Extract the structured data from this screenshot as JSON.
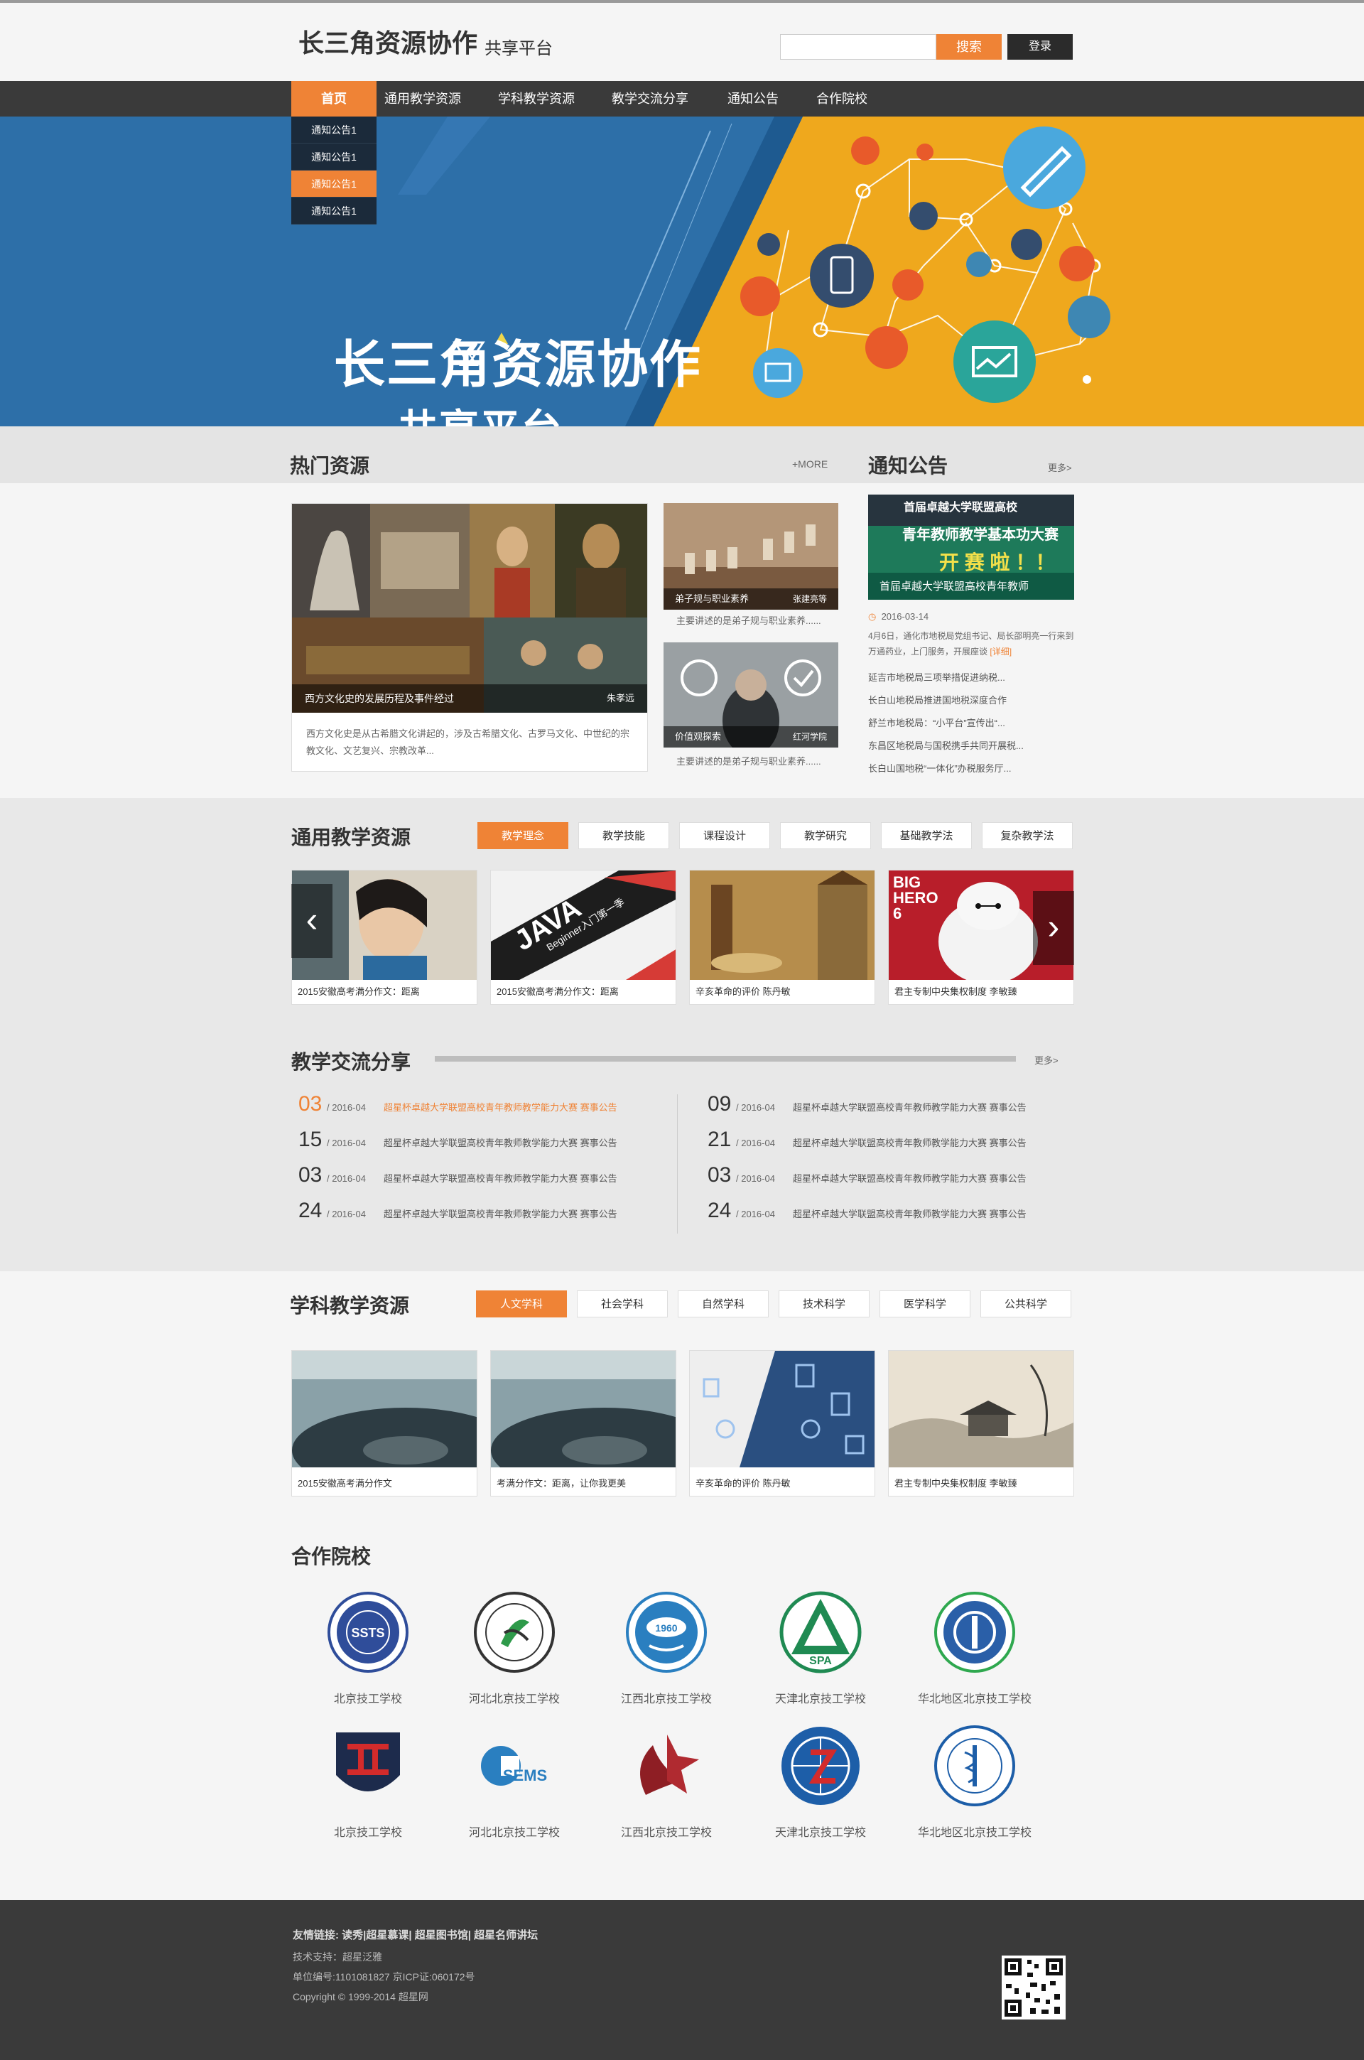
{
  "header": {
    "logo_main": "长三角资源协作",
    "logo_sub": "共享平台",
    "search_placeholder": "",
    "search_label": "搜索",
    "login_label": "登录"
  },
  "nav": {
    "items": [
      "首页",
      "通用教学资源",
      "学科教学资源",
      "教学交流分享",
      "通知公告",
      "合作院校"
    ],
    "dropdown": [
      "通知公告1",
      "通知公告1",
      "通知公告1",
      "通知公告1"
    ]
  },
  "banner": {
    "title": "长三角资源协作",
    "subtitle": "共享平台"
  },
  "hot": {
    "title": "热门资源",
    "more": "+MORE",
    "main": {
      "caption": "西方文化史的发展历程及事件经过",
      "author": "朱孝远",
      "desc": "西方文化史是从古希腊文化讲起的，涉及古希腊文化、古罗马文化、中世纪的宗教文化、文艺复兴、宗教改革..."
    },
    "side": [
      {
        "caption": "弟子规与职业素养",
        "author": "张建亮等",
        "desc": "主要讲述的是弟子规与职业素养......"
      },
      {
        "caption": "价值观探索",
        "author": "红河学院",
        "desc": "主要讲述的是弟子规与职业素养......"
      }
    ]
  },
  "notice": {
    "title": "通知公告",
    "more": "更多>",
    "img_line1": "首届卓越大学联盟高校",
    "img_line2": "青年教师教学基本功大赛",
    "img_line3": "开 赛 啦 ！！",
    "img_caption": "首届卓越大学联盟高校青年教师",
    "date": "2016-03-14",
    "summary": "4月6日，通化市地税局党组书记、局长邵明亮一行来到万通药业，上门服务，开展座谈",
    "detail": "[详细]",
    "items": [
      "延吉市地税局三项举措促进纳税...",
      "长白山地税局推进国地税深度合作",
      "舒兰市地税局：“小平台”宣传出“...",
      "东昌区地税局与国税携手共同开展税...",
      "长白山国地税“一体化”办税服务厅..."
    ]
  },
  "general": {
    "title": "通用教学资源",
    "tabs": [
      "教学理念",
      "教学技能",
      "课程设计",
      "教学研究",
      "基础教学法",
      "复杂教学法"
    ],
    "tiles": [
      "2015安徽高考满分作文：距离",
      "2015安徽高考满分作文：距离",
      "辛亥革命的评价    陈丹敏",
      "君主专制中央集权制度 李敏臻"
    ],
    "java_text": "JAVA",
    "java_sub": "Beginner入门第一季",
    "big_hero": "BIG HERO 6"
  },
  "exchange": {
    "title": "教学交流分享",
    "more": "更多>",
    "left": [
      {
        "day": "03",
        "date": "/ 2016-04",
        "text": "超星杯卓越大学联盟高校青年教师教学能力大赛 赛事公告"
      },
      {
        "day": "15",
        "date": "/ 2016-04",
        "text": "超星杯卓越大学联盟高校青年教师教学能力大赛 赛事公告"
      },
      {
        "day": "03",
        "date": "/ 2016-04",
        "text": "超星杯卓越大学联盟高校青年教师教学能力大赛 赛事公告"
      },
      {
        "day": "24",
        "date": "/ 2016-04",
        "text": "超星杯卓越大学联盟高校青年教师教学能力大赛 赛事公告"
      }
    ],
    "right": [
      {
        "day": "09",
        "date": "/ 2016-04",
        "text": "超星杯卓越大学联盟高校青年教师教学能力大赛 赛事公告"
      },
      {
        "day": "21",
        "date": "/ 2016-04",
        "text": "超星杯卓越大学联盟高校青年教师教学能力大赛 赛事公告"
      },
      {
        "day": "03",
        "date": "/ 2016-04",
        "text": "超星杯卓越大学联盟高校青年教师教学能力大赛 赛事公告"
      },
      {
        "day": "24",
        "date": "/ 2016-04",
        "text": "超星杯卓越大学联盟高校青年教师教学能力大赛 赛事公告"
      }
    ]
  },
  "subject": {
    "title": "学科教学资源",
    "tabs": [
      "人文学科",
      "社会学科",
      "自然学科",
      "技术科学",
      "医学科学",
      "公共科学"
    ],
    "tiles": [
      "2015安徽高考满分作文",
      "考满分作文：距离，让你我更美",
      "辛亥革命的评价    陈丹敏",
      "君主专制中央集权制度 李敏臻"
    ]
  },
  "partners": {
    "title": "合作院校",
    "row1": [
      "北京技工学校",
      "河北北京技工学校",
      "江西北京技工学校",
      "天津北京技工学校",
      "华北地区北京技工学校"
    ],
    "row2": [
      "北京技工学校",
      "河北北京技工学校",
      "江西北京技工学校",
      "天津北京技工学校",
      "华北地区北京技工学校"
    ],
    "emblem_text": {
      "e1": "SSTS",
      "e3": "1960",
      "e4": "SPA",
      "e7": "SEMS"
    }
  },
  "footer": {
    "links": "友情链接: 读秀|超星慕课| 超星图书馆| 超星名师讲坛",
    "support": "技术支持：超星泛雅",
    "license": "单位编号:1101081827    京ICP证:060172号",
    "copyright": "Copyright © 1999-2014 超星网"
  },
  "colors": {
    "accent": "#ef8336",
    "dark": "#3a3a3a",
    "banner_blue": "#2d6fa8",
    "banner_yellow": "#efa81d"
  }
}
